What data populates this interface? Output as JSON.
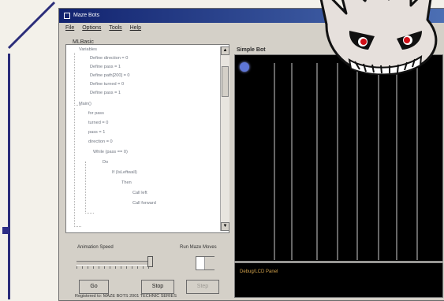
{
  "window": {
    "title": "Maze Bots",
    "menu": [
      "File",
      "Options",
      "Tools",
      "Help"
    ]
  },
  "left_panel": {
    "title": "MLBasic",
    "lines": [
      "Variables",
      "Define direction = 0",
      "Define pass = 1",
      "Define path[200] = 0",
      "Define turned = 0",
      "Define pass = 1",
      "Main()",
      "for pass",
      "turned = 0",
      "pass = 1",
      "direction = 0",
      "While (pass == 0)",
      "Do",
      "If (IsLeftwall)",
      "Then",
      "Call left",
      "Call forward"
    ]
  },
  "display": {
    "title": "Simple Bot"
  },
  "controls": {
    "speed_label": "Animation Speed",
    "moves_label": "Run Maze Moves",
    "spin_value": "",
    "go": "Go",
    "stop": "Stop",
    "step": "Step"
  },
  "log": {
    "line": "Debug/LCD Panel"
  },
  "status": {
    "text": "Registered to: MAZE BOTS 2001 TECHNIC SERIES"
  }
}
